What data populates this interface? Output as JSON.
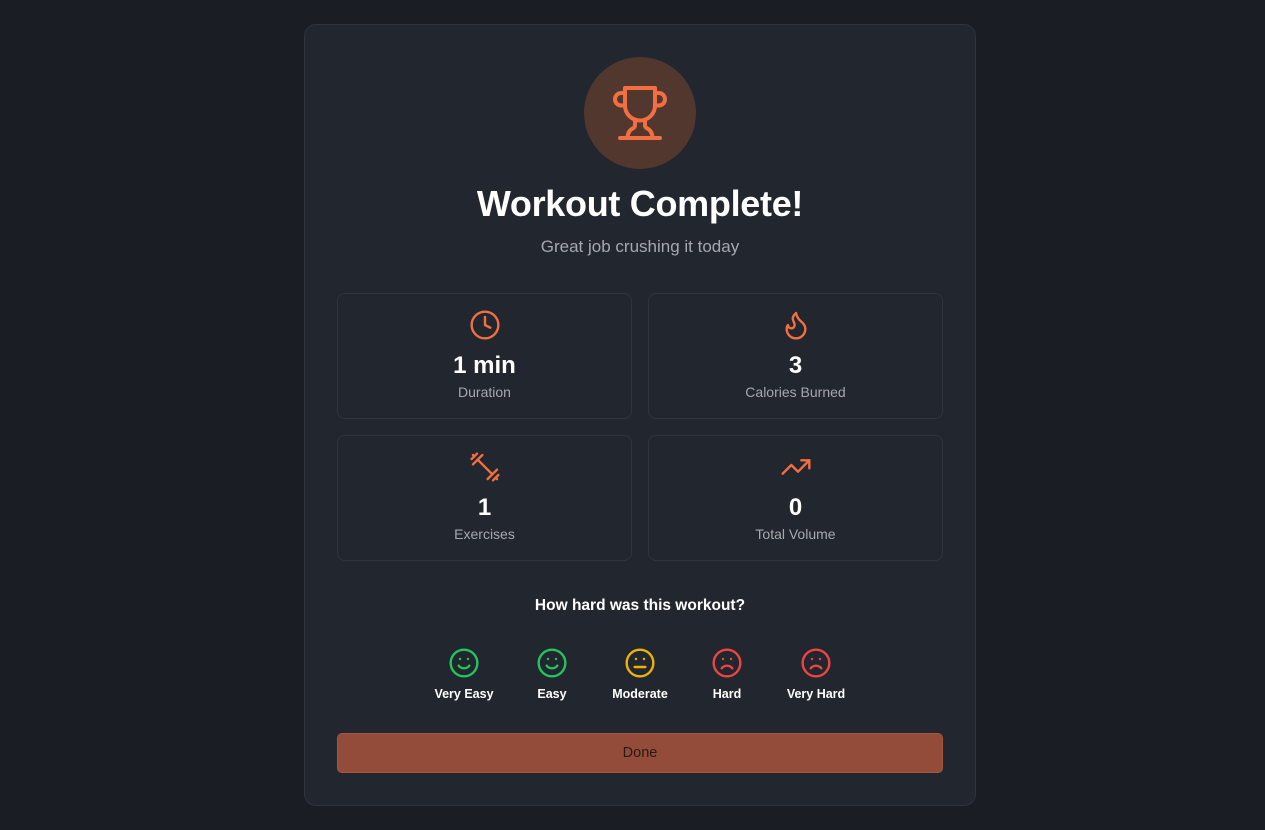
{
  "header": {
    "title": "Workout Complete!",
    "subtitle": "Great job crushing it today",
    "icon": "trophy-icon"
  },
  "colors": {
    "accent": "#f26f42",
    "easy": "#22c55e",
    "moderate": "#eab308",
    "hard": "#ef4444"
  },
  "stats": [
    {
      "icon": "clock-icon",
      "value": "1 min",
      "label": "Duration"
    },
    {
      "icon": "flame-icon",
      "value": "3",
      "label": "Calories Burned"
    },
    {
      "icon": "dumbbell-icon",
      "value": "1",
      "label": "Exercises"
    },
    {
      "icon": "trending-up-icon",
      "value": "0",
      "label": "Total Volume"
    }
  ],
  "difficulty": {
    "question": "How hard was this workout?",
    "options": [
      {
        "label": "Very Easy",
        "icon": "smile-icon"
      },
      {
        "label": "Easy",
        "icon": "smile-icon"
      },
      {
        "label": "Moderate",
        "icon": "meh-icon"
      },
      {
        "label": "Hard",
        "icon": "frown-icon"
      },
      {
        "label": "Very Hard",
        "icon": "frown-icon"
      }
    ]
  },
  "actions": {
    "done_label": "Done"
  }
}
